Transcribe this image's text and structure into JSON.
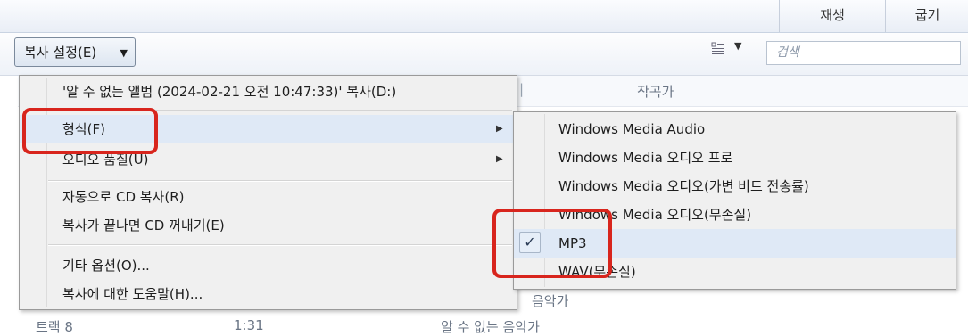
{
  "tabs": {
    "play": "재생",
    "burn": "굽기"
  },
  "toolbar": {
    "rip_settings_label": "복사 설정(E)",
    "search_placeholder": "검색"
  },
  "columns": {
    "composer": "작곡가"
  },
  "background_rows": [
    {
      "text": "음악가"
    },
    {
      "track": "트랙 8",
      "duration": "1:31",
      "artist": "알 수 없는 음악가"
    }
  ],
  "menu": {
    "items": [
      {
        "label": "'알 수 없는 앨범 (2024-02-21 오전 10:47:33)' 복사(D:)",
        "submenu": false
      },
      {
        "label": "형식(F)",
        "submenu": true
      },
      {
        "label": "오디오 품질(U)",
        "submenu": true
      },
      {
        "label": "자동으로 CD 복사(R)",
        "submenu": false
      },
      {
        "label": "복사가 끝나면 CD 꺼내기(E)",
        "submenu": false
      },
      {
        "label": "기타 옵션(O)...",
        "submenu": false
      },
      {
        "label": "복사에 대한 도움말(H)...",
        "submenu": false
      }
    ]
  },
  "submenu": {
    "items": [
      {
        "label": "Windows Media Audio",
        "checked": false
      },
      {
        "label": "Windows Media 오디오 프로",
        "checked": false
      },
      {
        "label": "Windows Media 오디오(가변 비트 전송률)",
        "checked": false
      },
      {
        "label": "Windows Media 오디오(무손실)",
        "checked": false
      },
      {
        "label": "MP3",
        "checked": true
      },
      {
        "label": "WAV(무손실)",
        "checked": false
      }
    ],
    "check_glyph": "✓"
  },
  "colors": {
    "annotation": "#d8251d",
    "menu_bg": "#f0f0f0"
  }
}
